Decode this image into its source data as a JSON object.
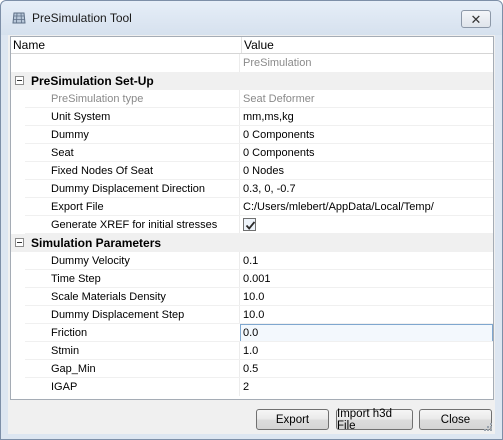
{
  "window": {
    "title": "PreSimulation Tool",
    "close_glyph": "✕",
    "icon": "grid-tool-icon"
  },
  "header": {
    "name": "Name",
    "value": "Value"
  },
  "top_value": "PreSimulation",
  "sections": [
    {
      "label": "PreSimulation Set-Up",
      "rows": [
        {
          "name": "PreSimulation type",
          "value": "Seat Deformer",
          "gray": true
        },
        {
          "name": "Unit System",
          "value": "mm,ms,kg"
        },
        {
          "name": "Dummy",
          "value": "0 Components"
        },
        {
          "name": "Seat",
          "value": "0 Components"
        },
        {
          "name": "Fixed Nodes Of Seat",
          "value": "0 Nodes"
        },
        {
          "name": "Dummy Displacement Direction",
          "value": "0.3, 0, -0.7"
        },
        {
          "name": "Export File",
          "value": "C:/Users/mlebert/AppData/Local/Temp/"
        },
        {
          "name": "Generate XREF for initial stresses",
          "checked": true
        }
      ]
    },
    {
      "label": "Simulation Parameters",
      "rows": [
        {
          "name": "Dummy Velocity",
          "value": "0.1"
        },
        {
          "name": "Time Step",
          "value": "0.001"
        },
        {
          "name": "Scale Materials Density",
          "value": "10.0"
        },
        {
          "name": "Dummy Displacement Step",
          "value": "10.0"
        },
        {
          "name": "Friction",
          "value": "0.0",
          "selected": true
        },
        {
          "name": "Stmin",
          "value": "1.0"
        },
        {
          "name": "Gap_Min",
          "value": "0.5"
        },
        {
          "name": "IGAP",
          "value": "2"
        }
      ]
    }
  ],
  "buttons": {
    "export": "Export",
    "import": "Import h3d File",
    "close": "Close"
  }
}
